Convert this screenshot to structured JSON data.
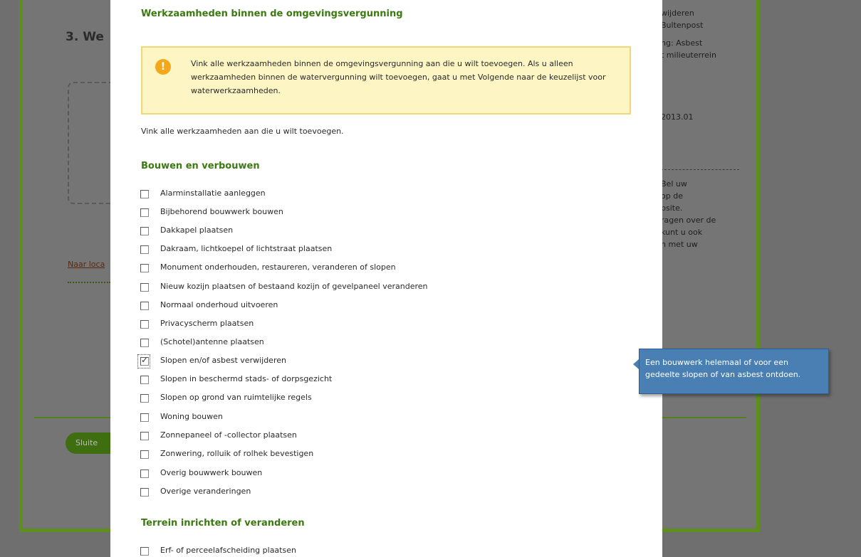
{
  "background": {
    "step_title": "3. We",
    "link_text": "Naar loca",
    "button_label": "Sluite",
    "right_lines_top": [
      "wijderen",
      "Bultenpost",
      "",
      "ng: Asbest",
      "t milieuterrein"
    ],
    "right_date": "2013.01",
    "right_lines_mid": [
      "Bel uw",
      "op de",
      "bsite.",
      "ragen over de",
      "kunt u ook",
      "n met uw"
    ]
  },
  "modal": {
    "title": "Werkzaamheden binnen de omgevingsvergunning",
    "warning_icon": "!",
    "warning_text": "Vink alle werkzaamheden binnen de omgevingsvergunning aan die u wilt toevoegen. Als u alleen werkzaamheden binnen de watervergunning wilt toevoegen, gaat u met Volgende naar de keuzelijst voor waterwerkzaamheden.",
    "intro": "Vink alle werkzaamheden aan die u wilt toevoegen.",
    "sections": [
      {
        "heading": "Bouwen en verbouwen",
        "options": [
          {
            "label": "Alarminstallatie aanleggen",
            "checked": false
          },
          {
            "label": "Bijbehorend bouwwerk bouwen",
            "checked": false
          },
          {
            "label": "Dakkapel plaatsen",
            "checked": false
          },
          {
            "label": "Dakraam, lichtkoepel of lichtstraat plaatsen",
            "checked": false
          },
          {
            "label": "Monument onderhouden, restaureren, veranderen of slopen",
            "checked": false
          },
          {
            "label": "Nieuw kozijn plaatsen of bestaand kozijn of gevelpaneel veranderen",
            "checked": false
          },
          {
            "label": "Normaal onderhoud uitvoeren",
            "checked": false
          },
          {
            "label": "Privacyscherm plaatsen",
            "checked": false
          },
          {
            "label": "(Schotel)antenne plaatsen",
            "checked": false
          },
          {
            "label": "Slopen en/of asbest verwijderen",
            "checked": true
          },
          {
            "label": "Slopen in beschermd stads- of dorpsgezicht",
            "checked": false
          },
          {
            "label": "Slopen op grond van ruimtelijke regels",
            "checked": false
          },
          {
            "label": "Woning bouwen",
            "checked": false
          },
          {
            "label": "Zonnepaneel of -collector plaatsen",
            "checked": false
          },
          {
            "label": "Zonwering, rolluik of rolhek bevestigen",
            "checked": false
          },
          {
            "label": "Overig bouwwerk bouwen",
            "checked": false
          },
          {
            "label": "Overige veranderingen",
            "checked": false
          }
        ]
      },
      {
        "heading": "Terrein inrichten of veranderen",
        "options": [
          {
            "label": "Erf- of perceelafscheiding plaatsen",
            "checked": false
          }
        ]
      }
    ]
  },
  "tooltip": {
    "text": "Een bouwwerk helemaal of voor een gedeelte slopen of van asbest ontdoen."
  },
  "colors": {
    "accent_green": "#3b7a10",
    "warning_bg": "#fdf5c4",
    "warning_icon": "#f2a81d",
    "tooltip_bg": "#4a7fb3"
  }
}
